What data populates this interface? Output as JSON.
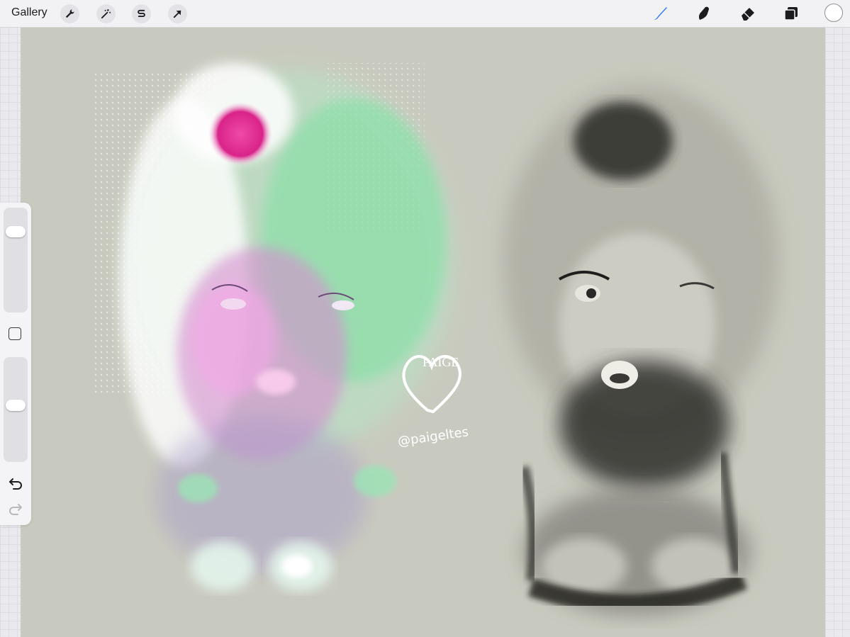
{
  "topbar": {
    "gallery_label": "Gallery",
    "left_tools": [
      {
        "name": "actions",
        "icon": "wrench-icon"
      },
      {
        "name": "adjustments",
        "icon": "magic-wand-icon"
      },
      {
        "name": "selection",
        "icon": "selection-s-icon"
      },
      {
        "name": "transform",
        "icon": "arrow-cursor-icon"
      }
    ],
    "right_tools": [
      {
        "name": "brush",
        "icon": "brush-icon",
        "active": true
      },
      {
        "name": "smudge",
        "icon": "smudge-icon",
        "active": false
      },
      {
        "name": "eraser",
        "icon": "eraser-icon",
        "active": false
      },
      {
        "name": "layers",
        "icon": "layers-icon",
        "active": false
      }
    ],
    "current_color": "#ffffff"
  },
  "sidebar": {
    "brush_size_level": 0.82,
    "opacity_level": 0.55,
    "modify_icon": "square-icon",
    "undo_icon": "undo-icon",
    "redo_icon": "redo-icon"
  },
  "canvas": {
    "background_color": "#c9cabf",
    "watermark": {
      "logo_text": "PAIGE",
      "handle": "@paigeltes"
    }
  },
  "colors": {
    "accent": "#2f7bf6",
    "toolbar": "#f2f2f5"
  }
}
